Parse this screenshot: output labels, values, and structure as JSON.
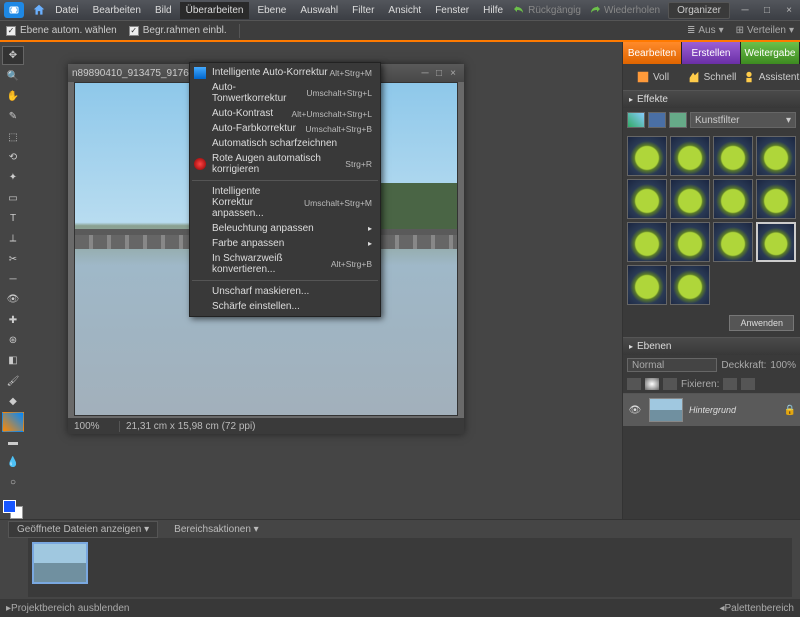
{
  "menu": {
    "items": [
      "Datei",
      "Bearbeiten",
      "Bild",
      "Überarbeiten",
      "Ebene",
      "Auswahl",
      "Filter",
      "Ansicht",
      "Fenster",
      "Hilfe"
    ],
    "undo": "Rückgängig",
    "redo": "Wiederholen",
    "organizer": "Organizer"
  },
  "optbar": {
    "auto_select": "Ebene autom. wählen",
    "show_bounds": "Begr.rahmen einbl.",
    "align": "Aus",
    "distribute": "Verteilen"
  },
  "dropdown": {
    "g1": [
      {
        "label": "Intelligente Auto-Korrektur",
        "shortcut": "Alt+Strg+M",
        "icon": true
      },
      {
        "label": "Auto-Tonwertkorrektur",
        "shortcut": "Umschalt+Strg+L"
      },
      {
        "label": "Auto-Kontrast",
        "shortcut": "Alt+Umschalt+Strg+L"
      },
      {
        "label": "Auto-Farbkorrektur",
        "shortcut": "Umschalt+Strg+B"
      },
      {
        "label": "Automatisch scharfzeichnen"
      },
      {
        "label": "Rote Augen automatisch korrigieren",
        "shortcut": "Strg+R",
        "redicon": true
      }
    ],
    "g2": [
      {
        "label": "Intelligente Korrektur anpassen...",
        "shortcut": "Umschalt+Strg+M"
      },
      {
        "label": "Beleuchtung anpassen",
        "sub": true
      },
      {
        "label": "Farbe anpassen",
        "sub": true
      },
      {
        "label": "In Schwarzweiß konvertieren...",
        "shortcut": "Alt+Strg+B"
      }
    ],
    "g3": [
      {
        "label": "Unscharf maskieren..."
      },
      {
        "label": "Schärfe einstellen..."
      }
    ]
  },
  "doc": {
    "title": "n89890410_913475_9176...",
    "zoom": "100%",
    "dims": "21,31 cm x 15,98 cm (72 ppi)"
  },
  "rtabs": {
    "t1": "Bearbeiten",
    "t2": "Erstellen",
    "t3": "Weitergabe"
  },
  "modes": {
    "full": "Voll",
    "quick": "Schnell",
    "guided": "Assistent"
  },
  "effects": {
    "title": "Effekte",
    "filter": "Kunstfilter",
    "apply": "Anwenden",
    "count": 14
  },
  "layers": {
    "title": "Ebenen",
    "blend": "Normal",
    "opacity_label": "Deckkraft:",
    "opacity": "100%",
    "lock_label": "Fixieren:",
    "bg": "Hintergrund"
  },
  "project": {
    "show": "Geöffnete Dateien anzeigen",
    "actions": "Bereichsaktionen"
  },
  "footer": {
    "left": "Projektbereich ausblenden",
    "right": "Palettenbereich"
  }
}
